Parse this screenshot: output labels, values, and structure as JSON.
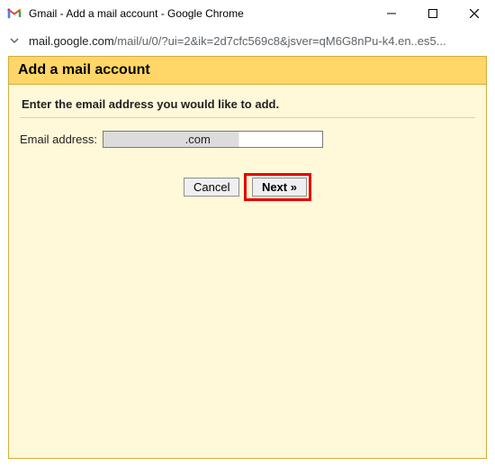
{
  "window": {
    "title": "Gmail - Add a mail account - Google Chrome"
  },
  "addressbar": {
    "domain": "mail.google.com",
    "path": "/mail/u/0/?ui=2&ik=2d7cfc569c8&jsver=qM6G8nPu-k4.en..es5..."
  },
  "page": {
    "header": "Add a mail account",
    "instruction": "Enter the email address you would like to add.",
    "email_label": "Email address:",
    "email_value": "                        .com",
    "cancel_label": "Cancel",
    "next_label": "Next »"
  }
}
